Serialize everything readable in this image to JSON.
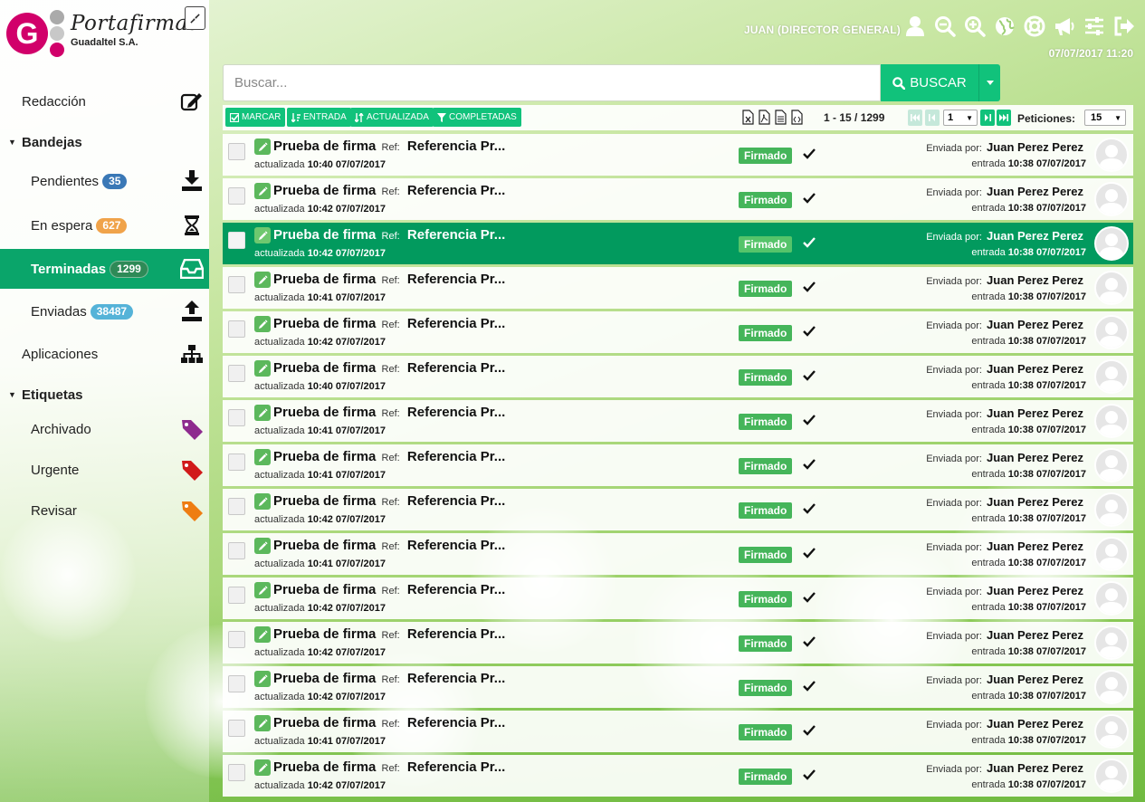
{
  "app": {
    "brand": "Portafirmas",
    "company": "Guadaltel S.A."
  },
  "colors": {
    "accent": "#11c27b",
    "active_nav": "#0aa56a",
    "selected_row": "#029a5e",
    "status": "#45b55a"
  },
  "sidebar": {
    "redaccion": "Redacción",
    "bandejas": "Bandejas",
    "pendientes": {
      "label": "Pendientes",
      "count": "35"
    },
    "en_espera": {
      "label": "En espera",
      "count": "627"
    },
    "terminadas": {
      "label": "Terminadas",
      "count": "1299"
    },
    "enviadas": {
      "label": "Enviadas",
      "count": "38487"
    },
    "aplicaciones": "Aplicaciones",
    "etiquetas": "Etiquetas",
    "tags": [
      {
        "label": "Archivado",
        "color": "#8e2a8e"
      },
      {
        "label": "Urgente",
        "color": "#d11a1a"
      },
      {
        "label": "Revisar",
        "color": "#ee7d12"
      }
    ]
  },
  "header": {
    "user": "JUAN (DIRECTOR GENERAL)",
    "datetime": "07/07/2017 11:20",
    "icons": [
      "user-icon",
      "zoom-out-icon",
      "zoom-in-icon",
      "globe-icon",
      "help-icon",
      "megaphone-icon",
      "settings-sliders-icon",
      "logout-icon"
    ]
  },
  "search": {
    "placeholder": "Buscar...",
    "button": "BUSCAR"
  },
  "toolbar": {
    "marcar": "MARCAR",
    "entrada": "ENTRADA",
    "actualizada": "ACTUALIZADA",
    "completadas": "COMPLETADAS",
    "range": "1 - 15 / 1299",
    "page": "1",
    "peticiones_label": "Peticiones:",
    "per_page": "15"
  },
  "list": {
    "subject": "Prueba de firma",
    "ref_label": "Ref:",
    "ref_value": "Referencia Pr...",
    "updated_label": "actualizada",
    "status": "Firmado",
    "sent_label": "Enviada por:",
    "sender": "Juan Perez Perez",
    "entry_label": "entrada",
    "entry_value": "10:38 07/07/2017",
    "selected_index": 2,
    "rows": [
      {
        "updated": "10:40 07/07/2017"
      },
      {
        "updated": "10:42 07/07/2017"
      },
      {
        "updated": "10:42 07/07/2017"
      },
      {
        "updated": "10:41 07/07/2017"
      },
      {
        "updated": "10:42 07/07/2017"
      },
      {
        "updated": "10:40 07/07/2017"
      },
      {
        "updated": "10:41 07/07/2017"
      },
      {
        "updated": "10:41 07/07/2017"
      },
      {
        "updated": "10:42 07/07/2017"
      },
      {
        "updated": "10:41 07/07/2017"
      },
      {
        "updated": "10:42 07/07/2017"
      },
      {
        "updated": "10:42 07/07/2017"
      },
      {
        "updated": "10:42 07/07/2017"
      },
      {
        "updated": "10:41 07/07/2017"
      },
      {
        "updated": "10:42 07/07/2017"
      }
    ]
  }
}
